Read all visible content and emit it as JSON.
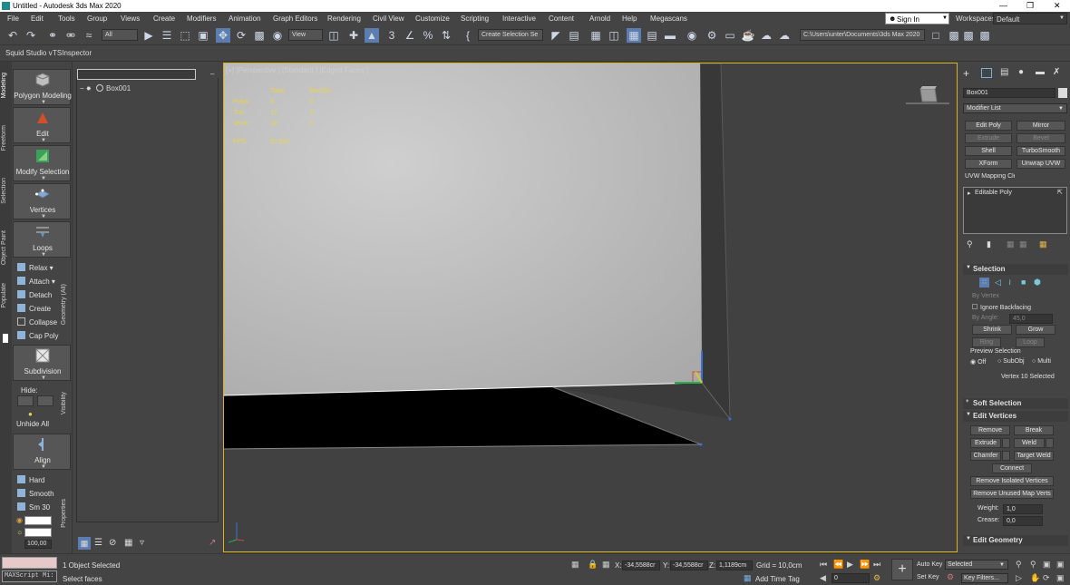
{
  "window": {
    "title": "Untitled - Autodesk 3ds Max 2020"
  },
  "menu": [
    "File",
    "Edit",
    "Tools",
    "Group",
    "Views",
    "Create",
    "Modifiers",
    "Animation",
    "Graph Editors",
    "Rendering",
    "Civil View",
    "Customize",
    "Scripting",
    "Interactive",
    "Content",
    "Arnold",
    "Help",
    "Megascans"
  ],
  "account": {
    "sign_in": "Sign In",
    "workspaces_label": "Workspaces:",
    "workspace": "Default"
  },
  "toolbar": {
    "filter": "All",
    "refcoord": "View",
    "selection_set": "Create Selection Se",
    "path": "C:\\Users\\unter\\Documents\\3ds Max 2020"
  },
  "ribbon_tabs": [
    "Squid Studio v",
    "TSInspector"
  ],
  "side_tabs": [
    "Modeling",
    "Freeform",
    "Selection",
    "Object Paint",
    "Populate"
  ],
  "ribbon": {
    "big_buttons": [
      "Polygon Modeling",
      "Edit",
      "Modify Selection",
      "Vertices",
      "Loops",
      "Subdivision",
      "Align"
    ],
    "geometry": [
      "Relax",
      "Attach",
      "Detach",
      "Create",
      "Collapse",
      "Cap Poly"
    ],
    "geometry_label": "Geometry (All)",
    "hide_label": "Hide:",
    "unhide_all": "Unhide All",
    "visibility_label": "Visibility",
    "properties": [
      "Hard",
      "Smooth",
      "Sm 30"
    ],
    "properties_label": "Properties",
    "percent": "100,00"
  },
  "explorer": {
    "object": "Box001"
  },
  "viewport": {
    "label": "[+] [Perspective ] [Standard ] [Edged Faces ]",
    "stats": {
      "headers": [
        "",
        "Total",
        "Box001"
      ],
      "rows": [
        [
          "Polys:",
          "6",
          "0"
        ],
        [
          "Tris:",
          "12",
          "0"
        ],
        [
          "Verts:",
          "10",
          "1"
        ]
      ],
      "fps_label": "FPS:",
      "fps": "51,541"
    }
  },
  "command_panel": {
    "object_name": "Box001",
    "modifier_list": "Modifier List",
    "buttons": [
      [
        "Edit Poly",
        "Mirror"
      ],
      [
        "Extrude",
        "Bevel"
      ],
      [
        "Shell",
        "TurboSmooth"
      ],
      [
        "XForm",
        "Unwrap UVW"
      ]
    ],
    "uvw_mapping": "UVW Mapping Clear",
    "stack_item": "Editable Poly",
    "selection": {
      "title": "Selection",
      "by_vertex": "By Vertex",
      "ignore_backfacing": "Ignore Backfacing",
      "by_angle": "By Angle:",
      "angle_value": "45,0",
      "shrink": "Shrink",
      "grow": "Grow",
      "ring": "Ring",
      "loop": "Loop",
      "preview_selection": "Preview Selection",
      "off": "Off",
      "subobj": "SubObj",
      "multi": "Multi",
      "status": "Vertex 10 Selected"
    },
    "soft_selection": "Soft Selection",
    "edit_vertices": {
      "title": "Edit Vertices",
      "remove": "Remove",
      "break": "Break",
      "extrude": "Extrude",
      "weld": "Weld",
      "chamfer": "Chamfer",
      "target_weld": "Target Weld",
      "connect": "Connect",
      "remove_isolated": "Remove Isolated Vertices",
      "remove_unused": "Remove Unused Map Verts",
      "weight_label": "Weight:",
      "weight": "1,0",
      "crease_label": "Crease:",
      "crease": "0,0"
    },
    "edit_geometry": "Edit Geometry"
  },
  "status": {
    "maxscript": "MAXScript Mi:",
    "selected": "1 Object Selected",
    "prompt": "Select faces",
    "x_label": "X:",
    "x": "-34,5588cr",
    "y_label": "Y:",
    "y": "-34,5588cr",
    "z_label": "Z:",
    "z": "1,1189cm",
    "grid": "Grid = 10,0cm",
    "add_time_tag": "Add Time Tag",
    "frame": "0",
    "auto_key": "Auto Key",
    "set_key": "Set Key",
    "key_mode": "Selected",
    "key_filters": "Key Filters..."
  }
}
